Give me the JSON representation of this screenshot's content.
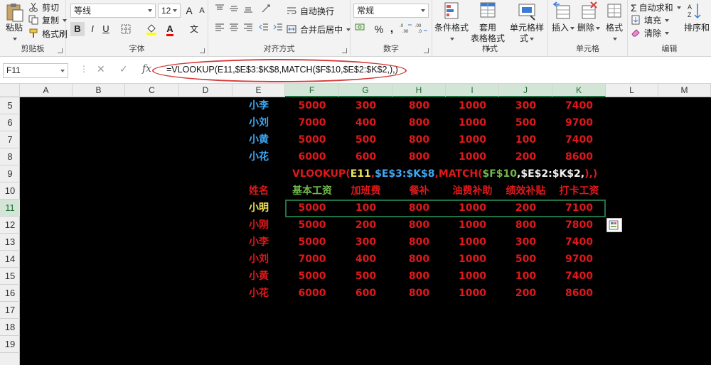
{
  "ribbon": {
    "clipboard": {
      "paste": "粘贴",
      "cut": "剪切",
      "copy": "复制",
      "format_painter": "格式刷",
      "label": "剪贴板"
    },
    "font": {
      "name": "等线",
      "size": "12",
      "grow": "A",
      "shrink": "A",
      "bold": "B",
      "italic": "I",
      "underline": "U",
      "phonetic": "文",
      "label": "字体"
    },
    "alignment": {
      "wrap_text": "自动换行",
      "merge_center": "合并后居中",
      "label": "对齐方式"
    },
    "number": {
      "format": "常规",
      "percent": "%",
      "comma": ",",
      "label": "数字"
    },
    "styles": {
      "conditional": "条件格式",
      "table_line1": "套用",
      "table_line2": "表格格式",
      "cell_styles": "单元格样式",
      "label": "样式"
    },
    "cells": {
      "insert": "插入",
      "delete": "删除",
      "format": "格式",
      "label": "单元格"
    },
    "editing": {
      "autosum": "自动求和",
      "fill": "填充",
      "clear": "清除",
      "sort": "排序和",
      "label": "编辑"
    }
  },
  "formula_bar": {
    "name_box": "F11",
    "fx": "fx",
    "cancel": "✕",
    "enter": "✓",
    "formula": "=VLOOKUP(E11,$E$3:$K$8,MATCH($F$10,$E$2:$K$2,),)"
  },
  "columns": [
    "A",
    "B",
    "C",
    "D",
    "E",
    "F",
    "G",
    "H",
    "I",
    "J",
    "K",
    "L",
    "M"
  ],
  "rows": [
    "5",
    "6",
    "7",
    "8",
    "9",
    "10",
    "11",
    "12",
    "13",
    "14",
    "15",
    "16",
    "17",
    "18",
    "19"
  ],
  "top_table": [
    [
      "小李",
      "5000",
      "300",
      "800",
      "1000",
      "300",
      "7400"
    ],
    [
      "小刘",
      "7000",
      "400",
      "800",
      "1000",
      "500",
      "9700"
    ],
    [
      "小黄",
      "5000",
      "500",
      "800",
      "1000",
      "100",
      "7400"
    ],
    [
      "小花",
      "6000",
      "600",
      "800",
      "1000",
      "200",
      "8600"
    ]
  ],
  "formula_label": {
    "p1": "VLOOKUP(",
    "p2": "E11",
    "p3": ",",
    "p4": "$E$3:$K$8",
    "p5": ",MATCH(",
    "p6": "$F$10",
    "p7": ",$E$2:$K$2,",
    "p8": "),)"
  },
  "header_row": [
    "姓名",
    "基本工资",
    "加班费",
    "餐补",
    "油费补助",
    "绩效补贴",
    "打卡工资"
  ],
  "bottom_table": [
    [
      "小明",
      "5000",
      "100",
      "800",
      "1000",
      "200",
      "7100"
    ],
    [
      "小刚",
      "5000",
      "200",
      "800",
      "1000",
      "800",
      "7800"
    ],
    [
      "小李",
      "5000",
      "300",
      "800",
      "1000",
      "300",
      "7400"
    ],
    [
      "小刘",
      "7000",
      "400",
      "800",
      "1000",
      "500",
      "9700"
    ],
    [
      "小黄",
      "5000",
      "500",
      "800",
      "1000",
      "100",
      "7400"
    ],
    [
      "小花",
      "6000",
      "600",
      "800",
      "1000",
      "200",
      "8600"
    ]
  ],
  "colors": {
    "name_blue": "#3fa9f5",
    "value_red": "#e0181b",
    "header_green": "#70b84a",
    "lookup_yellow": "#f0e25a",
    "selection_green": "#217346",
    "annotation_oval": "#d63b3b"
  },
  "icons": {
    "paste": "clipboard-icon",
    "cut": "scissors-icon",
    "copy": "copy-icon",
    "format_painter": "paintbrush-icon",
    "paste_options": "paste-options-icon"
  }
}
